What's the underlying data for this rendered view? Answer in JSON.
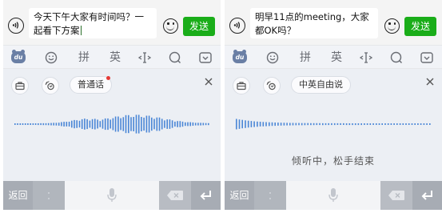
{
  "colors": {
    "send_green": "#1aad19",
    "wave_blue": "#4a86d6",
    "status_dot": "#e53935",
    "voice_panel_bg": "#eceff4"
  },
  "icons": {
    "voice_toggle": "voice-toggle-icon",
    "emoji": "emoji-icon",
    "du_logo": "du-logo-icon",
    "smiley": "smiley-icon",
    "cursor_move": "cursor-move-icon",
    "search": "search-icon",
    "collapse": "collapse-keyboard-icon",
    "toolbox": "toolbox-icon",
    "voice_effect": "voice-effect-icon",
    "close": "close-icon",
    "microphone": "microphone-icon",
    "delete": "backspace-icon",
    "enter": "enter-icon"
  },
  "panels": [
    {
      "message": "今天下午大家有时间吗？一起看下方案",
      "send_label": "发送",
      "toolbar": {
        "pinyin": "拼",
        "english": "英"
      },
      "language_label": "普通话",
      "status_text": "",
      "bottom": {
        "back_label": "返回"
      }
    },
    {
      "message": "明早11点的meeting，大家都OK吗？",
      "send_label": "发送",
      "toolbar": {
        "pinyin": "拼",
        "english": "英"
      },
      "language_label": "中英自由说",
      "status_text": "倾听中，松手结束",
      "bottom": {
        "back_label": "返回"
      }
    }
  ]
}
